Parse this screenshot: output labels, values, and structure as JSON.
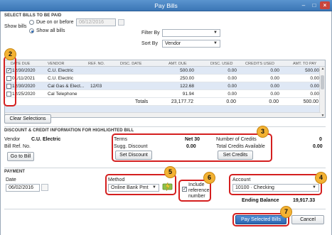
{
  "window": {
    "title": "Pay Bills"
  },
  "select_section": {
    "heading": "SELECT BILLS TO BE PAID",
    "show_bills_label": "Show bills",
    "due_on_or_before_label": "Due on or before",
    "due_date_value": "06/12/2016",
    "show_all_bills_label": "Show all bills",
    "filter_by_label": "Filter By",
    "filter_by_value": "",
    "sort_by_label": "Sort By",
    "sort_by_value": "Vendor"
  },
  "table": {
    "columns": [
      "DATE DUE",
      "VENDOR",
      "REF. NO.",
      "DISC. DATE",
      "AMT. DUE",
      "DISC. USED",
      "CREDITS USED",
      "AMT. TO PAY"
    ],
    "rows": [
      {
        "checked": true,
        "date_due": "12/30/2020",
        "vendor": "C.U. Electric",
        "ref_no": "",
        "disc_date": "",
        "amt_due": "500.00",
        "disc_used": "0.00",
        "credits_used": "0.00",
        "amt_to_pay": "500.00"
      },
      {
        "checked": false,
        "date_due": "01/11/2021",
        "vendor": "C.U. Electric",
        "ref_no": "",
        "disc_date": "",
        "amt_due": "250.00",
        "disc_used": "0.00",
        "credits_used": "0.00",
        "amt_to_pay": "0.00"
      },
      {
        "checked": false,
        "date_due": "12/30/2020",
        "vendor": "Cal Gas & Elect...",
        "ref_no": "12/03",
        "disc_date": "",
        "amt_due": "122.68",
        "disc_used": "0.00",
        "credits_used": "0.00",
        "amt_to_pay": "0.00"
      },
      {
        "checked": false,
        "date_due": "12/25/2020",
        "vendor": "Cal Telephone",
        "ref_no": "",
        "disc_date": "",
        "amt_due": "91.94",
        "disc_used": "0.00",
        "credits_used": "0.00",
        "amt_to_pay": "0.00"
      }
    ],
    "totals_label": "Totals",
    "total_amt_due": "23,177.72",
    "total_disc_used": "0.00",
    "total_credits_used": "0.00",
    "total_amt_to_pay": "500.00"
  },
  "clear_selections_label": "Clear Selections",
  "discount_section": {
    "heading": "DISCOUNT & CREDIT INFORMATION FOR HIGHLIGHTED BILL",
    "vendor_label": "Vendor",
    "vendor_value": "C.U. Electric",
    "bill_ref_label": "Bill Ref. No.",
    "go_to_bill_label": "Go to Bill",
    "terms_label": "Terms",
    "terms_value": "Net 30",
    "sugg_discount_label": "Sugg. Discount",
    "sugg_discount_value": "0.00",
    "set_discount_label": "Set Discount",
    "num_credits_label": "Number of Credits",
    "num_credits_value": "0",
    "total_credits_label": "Total Credits Available",
    "total_credits_value": "0.00",
    "set_credits_label": "Set Credits"
  },
  "payment_section": {
    "heading": "PAYMENT",
    "date_label": "Date",
    "date_value": "06/02/2016",
    "method_label": "Method",
    "method_value": "Online Bank Pmt",
    "include_ref_label_1": "Include",
    "include_ref_label_2": "reference",
    "include_ref_label_3": "number",
    "include_ref_checked": true,
    "account_label": "Account",
    "account_value": "10100 · Checking",
    "ending_balance_label": "Ending Balance",
    "ending_balance_value": "19,917.33"
  },
  "buttons": {
    "pay_selected": "Pay Selected Bills",
    "cancel": "Cancel"
  },
  "callouts": [
    "2",
    "3",
    "4",
    "5",
    "6",
    "7"
  ],
  "colors": {
    "callout_border": "#d41f1f",
    "callout_badge": "#f3b233",
    "title_bar": "#4a86c4",
    "row_highlight": "#dfe8f5"
  },
  "icons": [
    "close-icon",
    "minimize-icon",
    "maximize-icon",
    "calendar-icon",
    "chevron-down-icon",
    "online-payment-icon"
  ]
}
